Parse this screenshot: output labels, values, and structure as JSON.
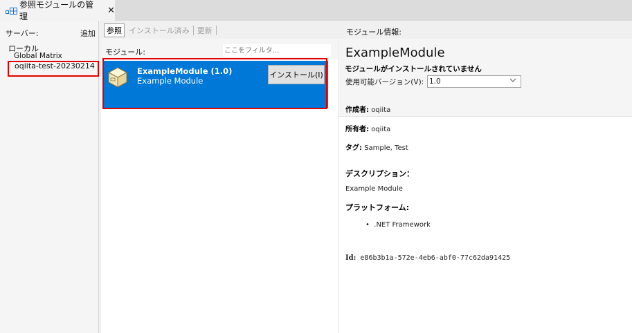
{
  "window": {
    "tab_title": "参照モジュールの管理",
    "close_glyph": "✕"
  },
  "servers": {
    "header_label": "サーバー:",
    "add_label": "追加",
    "items": [
      "ローカル",
      "Global Matrix",
      "oqiita-test-20230214"
    ]
  },
  "browser": {
    "tabs": [
      "参照",
      "インストール済み",
      "更新"
    ],
    "list_header": "モジュール:",
    "filter_placeholder": "ここをフィルタ...",
    "item": {
      "name": "ExampleModule (1.0)",
      "description": "Example Module",
      "install_label": "インストール(I)",
      "icon": "package-box-icon"
    }
  },
  "details": {
    "header": "モジュール情報:",
    "title": "ExampleModule",
    "status": "モジュールがインストールされていません",
    "version_label": "使用可能バージョン(V):",
    "version_value": "1.0",
    "author_label": "作成者:",
    "author_value": "oqiita",
    "owner_label": "所有者:",
    "owner_value": "oqiita",
    "tags_label": "タグ:",
    "tags_value": "Sample, Test",
    "description_heading": "デスクリプション：",
    "description_value": "Example Module",
    "platform_heading": "プラットフォーム:",
    "platform_items": [
      ".NET Framework"
    ],
    "id_label": "Id:",
    "id_value": "e86b3b1a-572e-4eb6-abf0-77c62da91425"
  },
  "colors": {
    "selection": "#0078d7",
    "highlight_box": "#e00000"
  }
}
